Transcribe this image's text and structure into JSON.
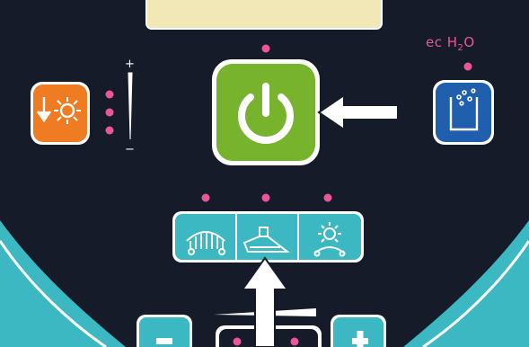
{
  "colors": {
    "panel_background": "#161b2a",
    "side_teal": "#3cb8c3",
    "power_green": "#78b32e",
    "heat_orange": "#ef7b22",
    "ech2o_blue": "#1f5fae",
    "indicator_pink": "#e8579a",
    "display_window": "#f2e7b6",
    "arrow": "#ffffff"
  },
  "intensity_scale": {
    "plus_label": "+",
    "minus_label": "−"
  },
  "ech2o": {
    "brand_prefix": "ec",
    "brand_h": "H",
    "brand_sub": "2",
    "brand_o": "O"
  },
  "icons": {
    "heat": "heat-down-arrow-sun-icon",
    "power": "power-icon",
    "ech2o": "water-beaker-bubbles-icon",
    "scrub": "brush-deck-icon",
    "squeegee": "squeegee-icon",
    "combined": "brush-sun-icon",
    "pointer_right": "arrow-left-pointer-icon",
    "pointer_bottom": "arrow-up-pointer-icon"
  },
  "indicators": {
    "power_on": true,
    "heat_levels": 3,
    "ech2o_on": true,
    "mode_count": 3
  }
}
